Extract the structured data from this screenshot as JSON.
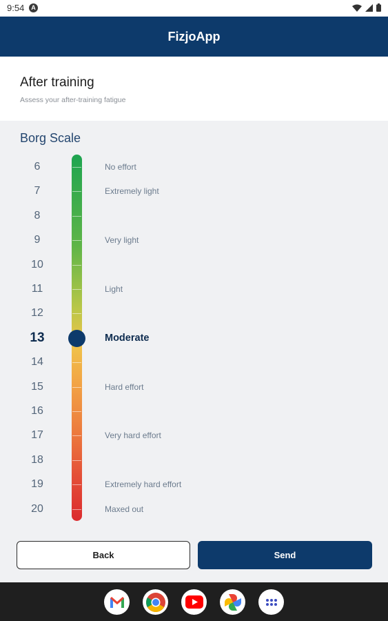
{
  "status_bar": {
    "time": "9:54",
    "notification_icon": "android-auto-icon",
    "right_icons": [
      "wifi-icon",
      "signal-icon",
      "battery-icon"
    ]
  },
  "app_bar": {
    "title": "FizjoApp",
    "color": "#0d3a6b"
  },
  "header": {
    "title": "After training",
    "subtitle": "Assess your after-training fatigue"
  },
  "scale": {
    "title": "Borg Scale",
    "selected_value": 13,
    "rows": [
      {
        "num": "6",
        "label": "No effort"
      },
      {
        "num": "7",
        "label": "Extremely light"
      },
      {
        "num": "8",
        "label": ""
      },
      {
        "num": "9",
        "label": "Very light"
      },
      {
        "num": "10",
        "label": ""
      },
      {
        "num": "11",
        "label": "Light"
      },
      {
        "num": "12",
        "label": ""
      },
      {
        "num": "13",
        "label": "Moderate"
      },
      {
        "num": "14",
        "label": ""
      },
      {
        "num": "15",
        "label": "Hard effort"
      },
      {
        "num": "16",
        "label": ""
      },
      {
        "num": "17",
        "label": "Very hard effort"
      },
      {
        "num": "18",
        "label": ""
      },
      {
        "num": "19",
        "label": "Extremely hard effort"
      },
      {
        "num": "20",
        "label": "Maxed out"
      }
    ]
  },
  "actions": {
    "back_label": "Back",
    "send_label": "Send"
  },
  "dock": {
    "apps": [
      "gmail-icon",
      "chrome-icon",
      "youtube-icon",
      "photos-icon",
      "app-drawer-icon"
    ]
  }
}
